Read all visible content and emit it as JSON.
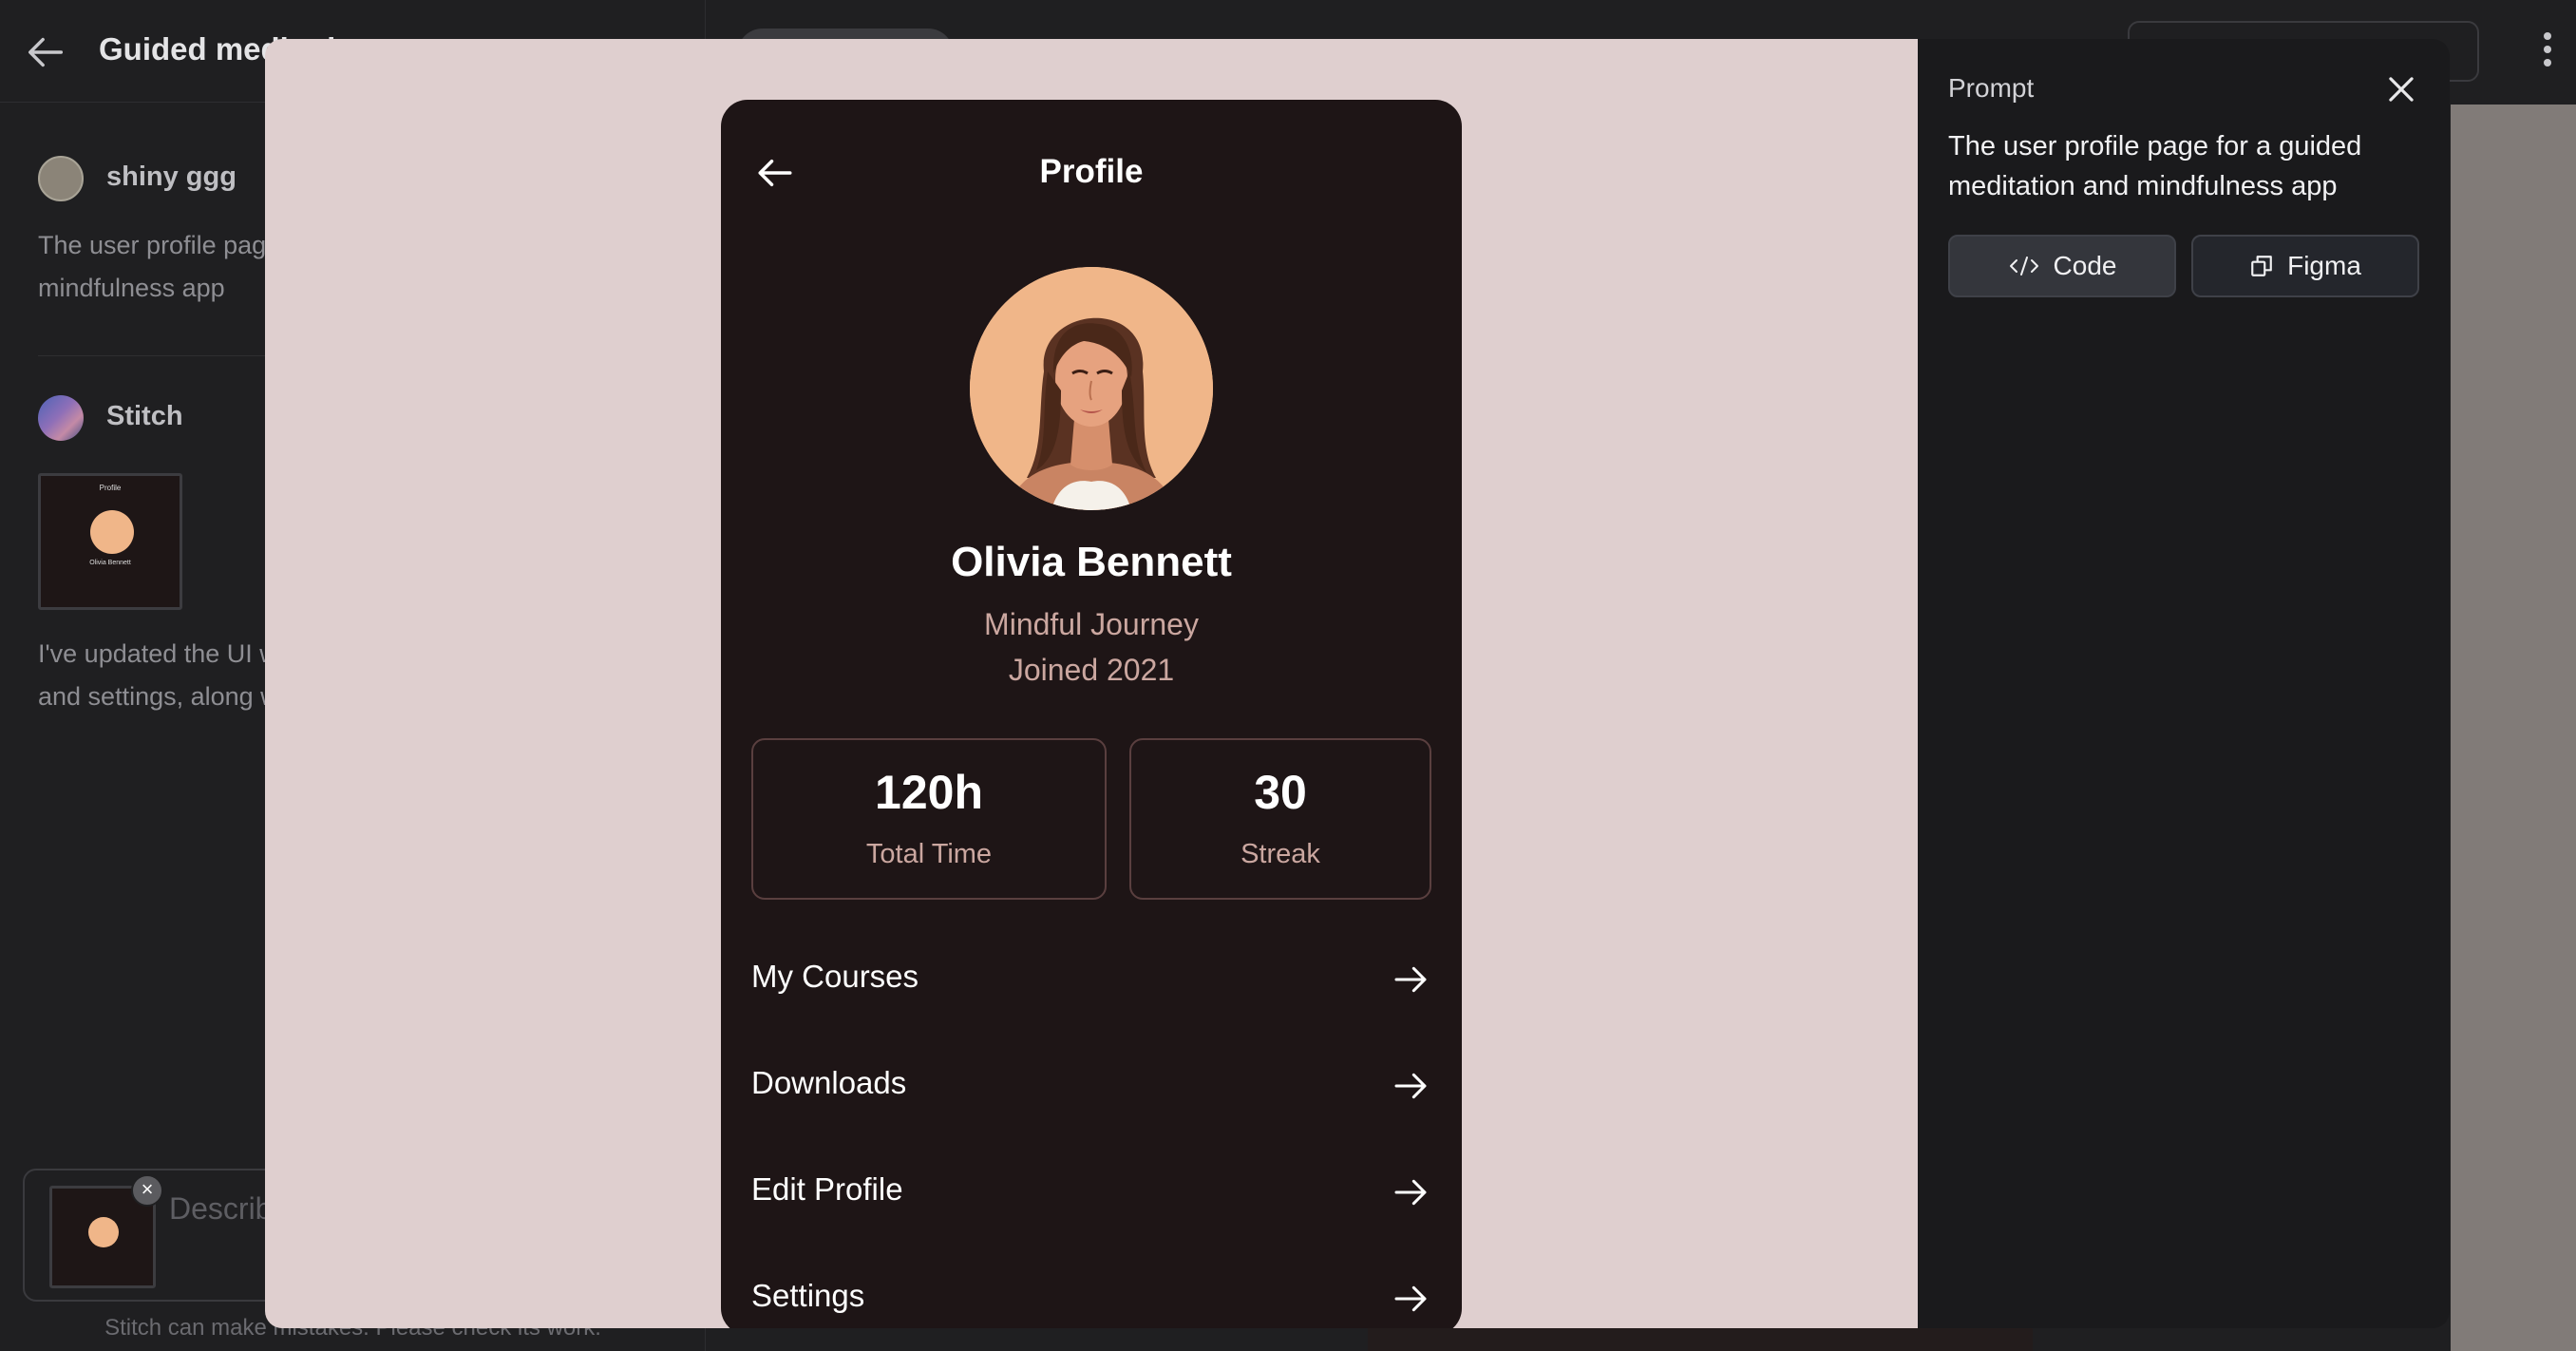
{
  "left_panel": {
    "title": "Guided meditation",
    "messages": [
      {
        "author": "shiny ggg",
        "text": "The user profile page for a guided meditation and mindfulness app"
      },
      {
        "author": "Stitch",
        "text": "I've updated the UI with sections for 'My Courses' and settings, along with"
      }
    ],
    "thumbnail": {
      "title": "Profile",
      "name": "Olivia Bennett"
    },
    "input_placeholder": "Describe your design",
    "disclaimer": "Stitch can make mistakes. Please check its work."
  },
  "prompt_panel": {
    "label": "Prompt",
    "text": "The user profile page for a guided meditation and mindfulness app",
    "code_label": "Code",
    "figma_label": "Figma"
  },
  "profile": {
    "title": "Profile",
    "name": "Olivia Bennett",
    "tagline": "Mindful Journey",
    "joined": "Joined 2021",
    "stats": [
      {
        "value": "120h",
        "label": "Total Time"
      },
      {
        "value": "30",
        "label": "Streak"
      }
    ],
    "menu": [
      {
        "label": "My Courses"
      },
      {
        "label": "Downloads"
      },
      {
        "label": "Edit Profile"
      },
      {
        "label": "Settings"
      }
    ]
  },
  "colors": {
    "preview_bg": "#dfcfcf",
    "phone_bg": "#1e1516",
    "accent_text": "#cba7a0",
    "avatar_bg": "#f0b689",
    "stat_border": "#5a3f3f"
  }
}
